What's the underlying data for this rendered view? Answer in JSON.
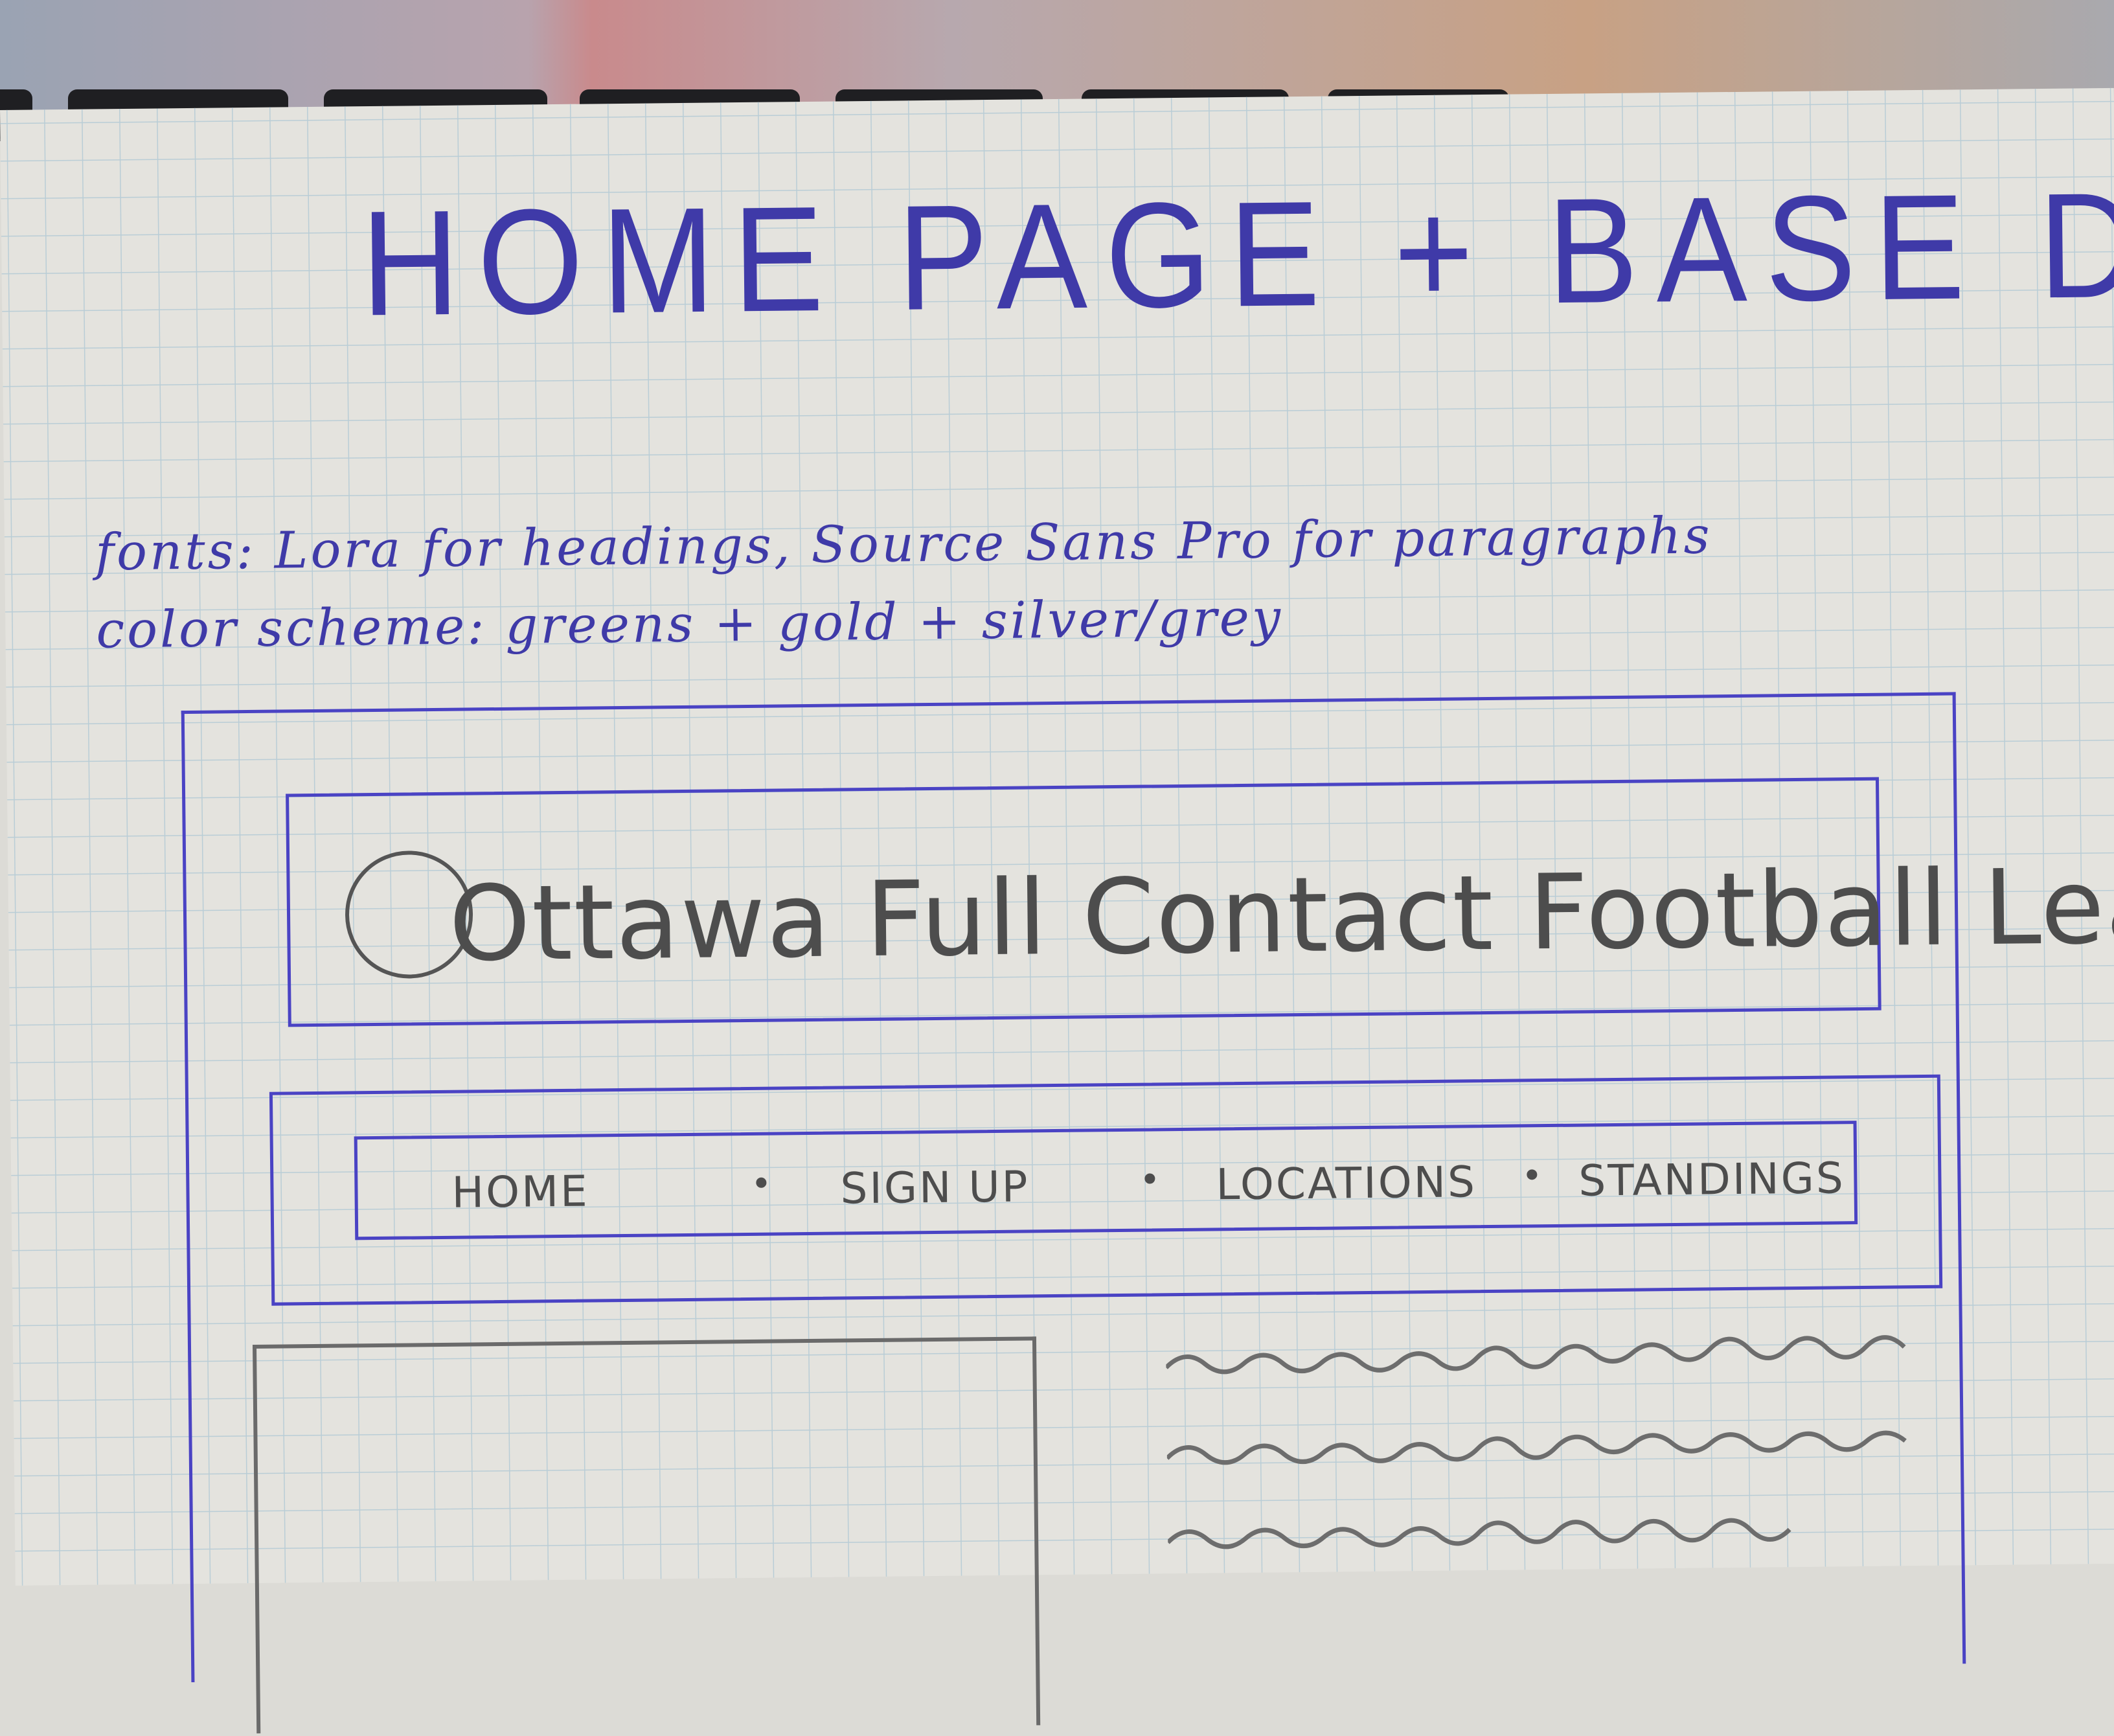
{
  "keyboard": {
    "keys": [
      "▭▭",
      "▫▫▫",
      "",
      "",
      "",
      ""
    ]
  },
  "sketch": {
    "title": "HOME PAGE + BASE DESIGN",
    "notes": [
      "fonts: Lora for headings, Source Sans Pro for paragraphs",
      "color scheme: greens + gold + silver/grey"
    ],
    "header": {
      "site_title": "Ottawa Full Contact Football League"
    },
    "nav": {
      "items": [
        "HOME",
        "SIGN UP",
        "LOCATIONS",
        "STANDINGS"
      ]
    }
  }
}
